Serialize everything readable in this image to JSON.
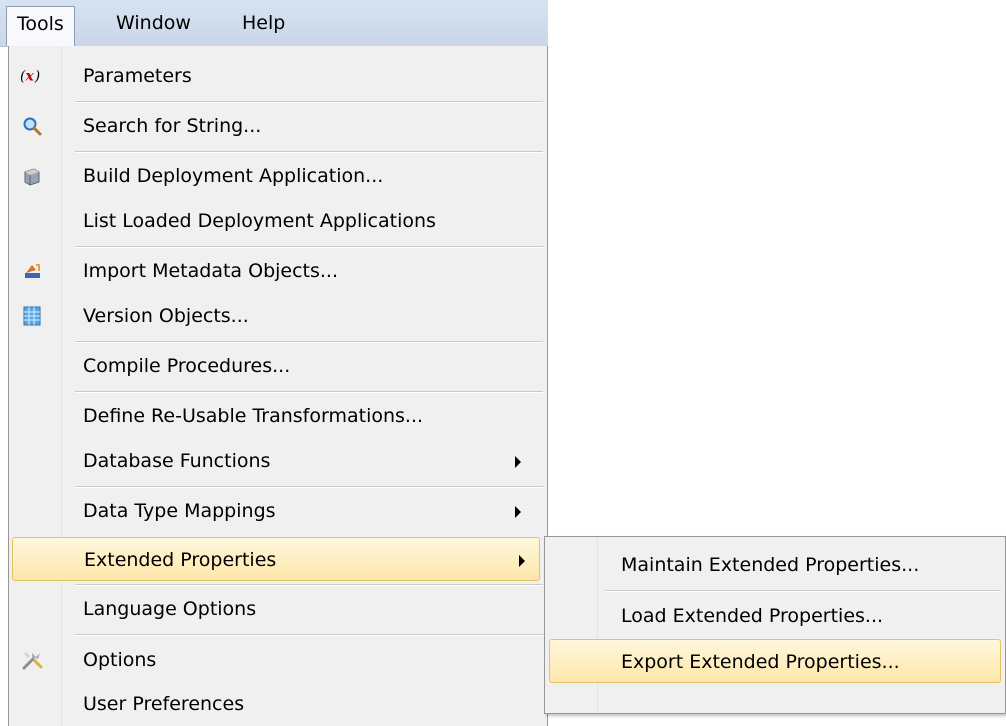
{
  "menubar": {
    "items": [
      {
        "label": "Tools",
        "active": true
      },
      {
        "label": "Window",
        "active": false
      },
      {
        "label": "Help",
        "active": false
      }
    ]
  },
  "tools_menu": {
    "items": [
      {
        "label": "Parameters",
        "icon": "parameters-x-icon"
      },
      {
        "label": "Search for String...",
        "icon": "magnifier-icon"
      },
      {
        "label": "Build Deployment Application...",
        "icon": "package-icon"
      },
      {
        "label": "List Loaded Deployment Applications",
        "icon": ""
      },
      {
        "label": "Import Metadata Objects...",
        "icon": "import-icon"
      },
      {
        "label": "Version Objects...",
        "icon": "grid-icon"
      },
      {
        "label": "Compile Procedures...",
        "icon": ""
      },
      {
        "label": "Define Re-Usable Transformations...",
        "icon": ""
      },
      {
        "label": "Database Functions",
        "icon": "",
        "submenu": true
      },
      {
        "label": "Data Type Mappings",
        "icon": "",
        "submenu": true
      },
      {
        "label": "Extended Properties",
        "icon": "",
        "submenu": true,
        "highlighted": true
      },
      {
        "label": "Language Options",
        "icon": ""
      },
      {
        "label": "Options",
        "icon": "wrench-icon"
      },
      {
        "label": "User Preferences",
        "icon": ""
      }
    ]
  },
  "extended_properties_submenu": {
    "items": [
      {
        "label": "Maintain Extended Properties..."
      },
      {
        "label": "Load Extended Properties..."
      },
      {
        "label": "Export Extended Properties...",
        "highlighted": true
      }
    ]
  },
  "colors": {
    "highlight_fill": "#fde7a9",
    "highlight_border": "#e5c365",
    "menubar_bg": "#d0dcec",
    "menu_bg": "#f0f0f0"
  }
}
